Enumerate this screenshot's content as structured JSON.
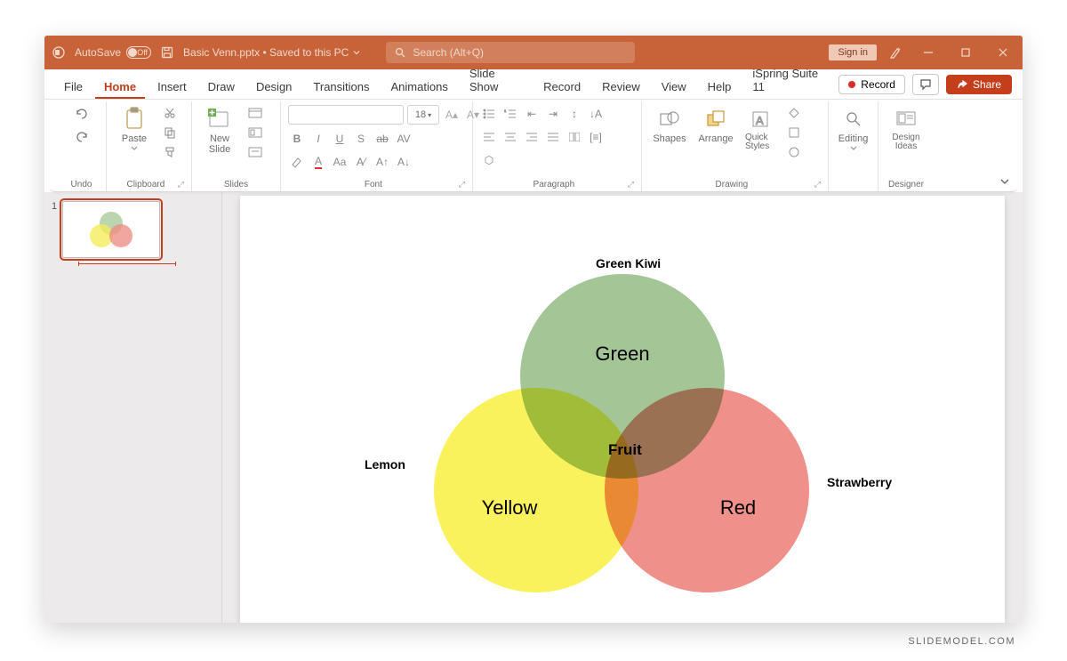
{
  "titlebar": {
    "autosave_label": "AutoSave",
    "autosave_state": "Off",
    "filename": "Basic Venn.pptx • Saved to this PC",
    "search_placeholder": "Search (Alt+Q)",
    "signin": "Sign in"
  },
  "tabs": {
    "items": [
      "File",
      "Home",
      "Insert",
      "Draw",
      "Design",
      "Transitions",
      "Animations",
      "Slide Show",
      "Record",
      "Review",
      "View",
      "Help",
      "iSpring Suite 11"
    ],
    "active": "Home",
    "record": "Record",
    "share": "Share"
  },
  "ribbon": {
    "undo": "Undo",
    "clipboard": {
      "label": "Clipboard",
      "paste": "Paste"
    },
    "slides": {
      "label": "Slides",
      "newslide": "New Slide"
    },
    "font": {
      "label": "Font",
      "size": "18",
      "bold": "B",
      "italic": "I",
      "underline": "U",
      "strike": "S"
    },
    "paragraph": {
      "label": "Paragraph"
    },
    "drawing": {
      "label": "Drawing",
      "shapes": "Shapes",
      "arrange": "Arrange",
      "quick": "Quick Styles"
    },
    "editing": {
      "label": "",
      "btn": "Editing"
    },
    "designer": {
      "label": "Designer",
      "btn": "Design Ideas"
    }
  },
  "thumbnail": {
    "num": "1"
  },
  "venn": {
    "green": "Green",
    "yellow": "Yellow",
    "red": "Red",
    "center": "Fruit",
    "top_label": "Green Kiwi",
    "left_label": "Lemon",
    "right_label": "Strawberry"
  },
  "watermark": "SLIDEMODEL.COM",
  "chart_data": {
    "type": "venn",
    "sets": [
      {
        "name": "Green",
        "outer_label": "Green Kiwi",
        "color": "#90ba80"
      },
      {
        "name": "Yellow",
        "outer_label": "Lemon",
        "color": "#f8f041"
      },
      {
        "name": "Red",
        "outer_label": "Strawberry",
        "color": "#eb7870"
      }
    ],
    "intersection_label": "Fruit",
    "title": ""
  }
}
